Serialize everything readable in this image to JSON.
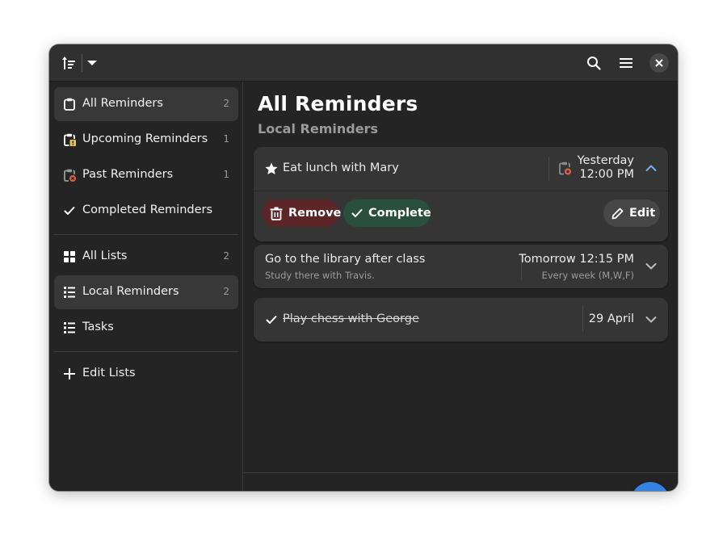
{
  "colors": {
    "accent": "#3584e4",
    "destructive_bg": "#5c2528",
    "success_bg": "#2a4f3c",
    "warning": "#e5c44a",
    "error": "#e0604a"
  },
  "headerbar": {
    "sort_icon": "sort-ascending-icon",
    "dropdown_icon": "pan-down-icon",
    "search_icon": "search-icon",
    "menu_icon": "hamburger-menu-icon",
    "close_icon": "close-icon"
  },
  "sidebar": {
    "sections": [
      {
        "items": [
          {
            "label": "All Reminders",
            "count": "2",
            "icon": "clipboard-icon",
            "selected": true
          },
          {
            "label": "Upcoming Reminders",
            "count": "1",
            "icon": "clipboard-warning-icon",
            "selected": false
          },
          {
            "label": "Past Reminders",
            "count": "1",
            "icon": "clipboard-error-icon",
            "selected": false
          },
          {
            "label": "Completed Reminders",
            "count": "",
            "icon": "checkmark-icon",
            "selected": false
          }
        ]
      },
      {
        "items": [
          {
            "label": "All Lists",
            "count": "2",
            "icon": "grid-icon",
            "selected": false
          },
          {
            "label": "Local Reminders",
            "count": "2",
            "icon": "list-icon",
            "selected": true
          },
          {
            "label": "Tasks",
            "count": "",
            "icon": "list-icon",
            "selected": false
          }
        ]
      },
      {
        "items": [
          {
            "label": "Edit Lists",
            "count": "",
            "icon": "plus-icon",
            "selected": false
          }
        ]
      }
    ]
  },
  "main": {
    "title": "All Reminders",
    "subtitle": "Local Reminders",
    "reminders": [
      {
        "title": "Eat lunch with Mary",
        "important": true,
        "completed": false,
        "expanded": true,
        "status_icon": "clipboard-error-icon",
        "date_line1": "Yesterday",
        "date_line2": "12:00 PM",
        "actions": {
          "remove_label": "Remove",
          "complete_label": "Complete",
          "edit_label": "Edit"
        }
      },
      {
        "title": "Go to the library after class",
        "notes": "Study there with Travis.",
        "completed": false,
        "expanded": false,
        "date": "Tomorrow 12:15 PM",
        "repeat": "Every week (M,W,F)"
      },
      {
        "title": "Play chess with George",
        "completed": true,
        "expanded": false,
        "date": "29 April"
      }
    ],
    "add_button_icon": "plus-icon"
  }
}
